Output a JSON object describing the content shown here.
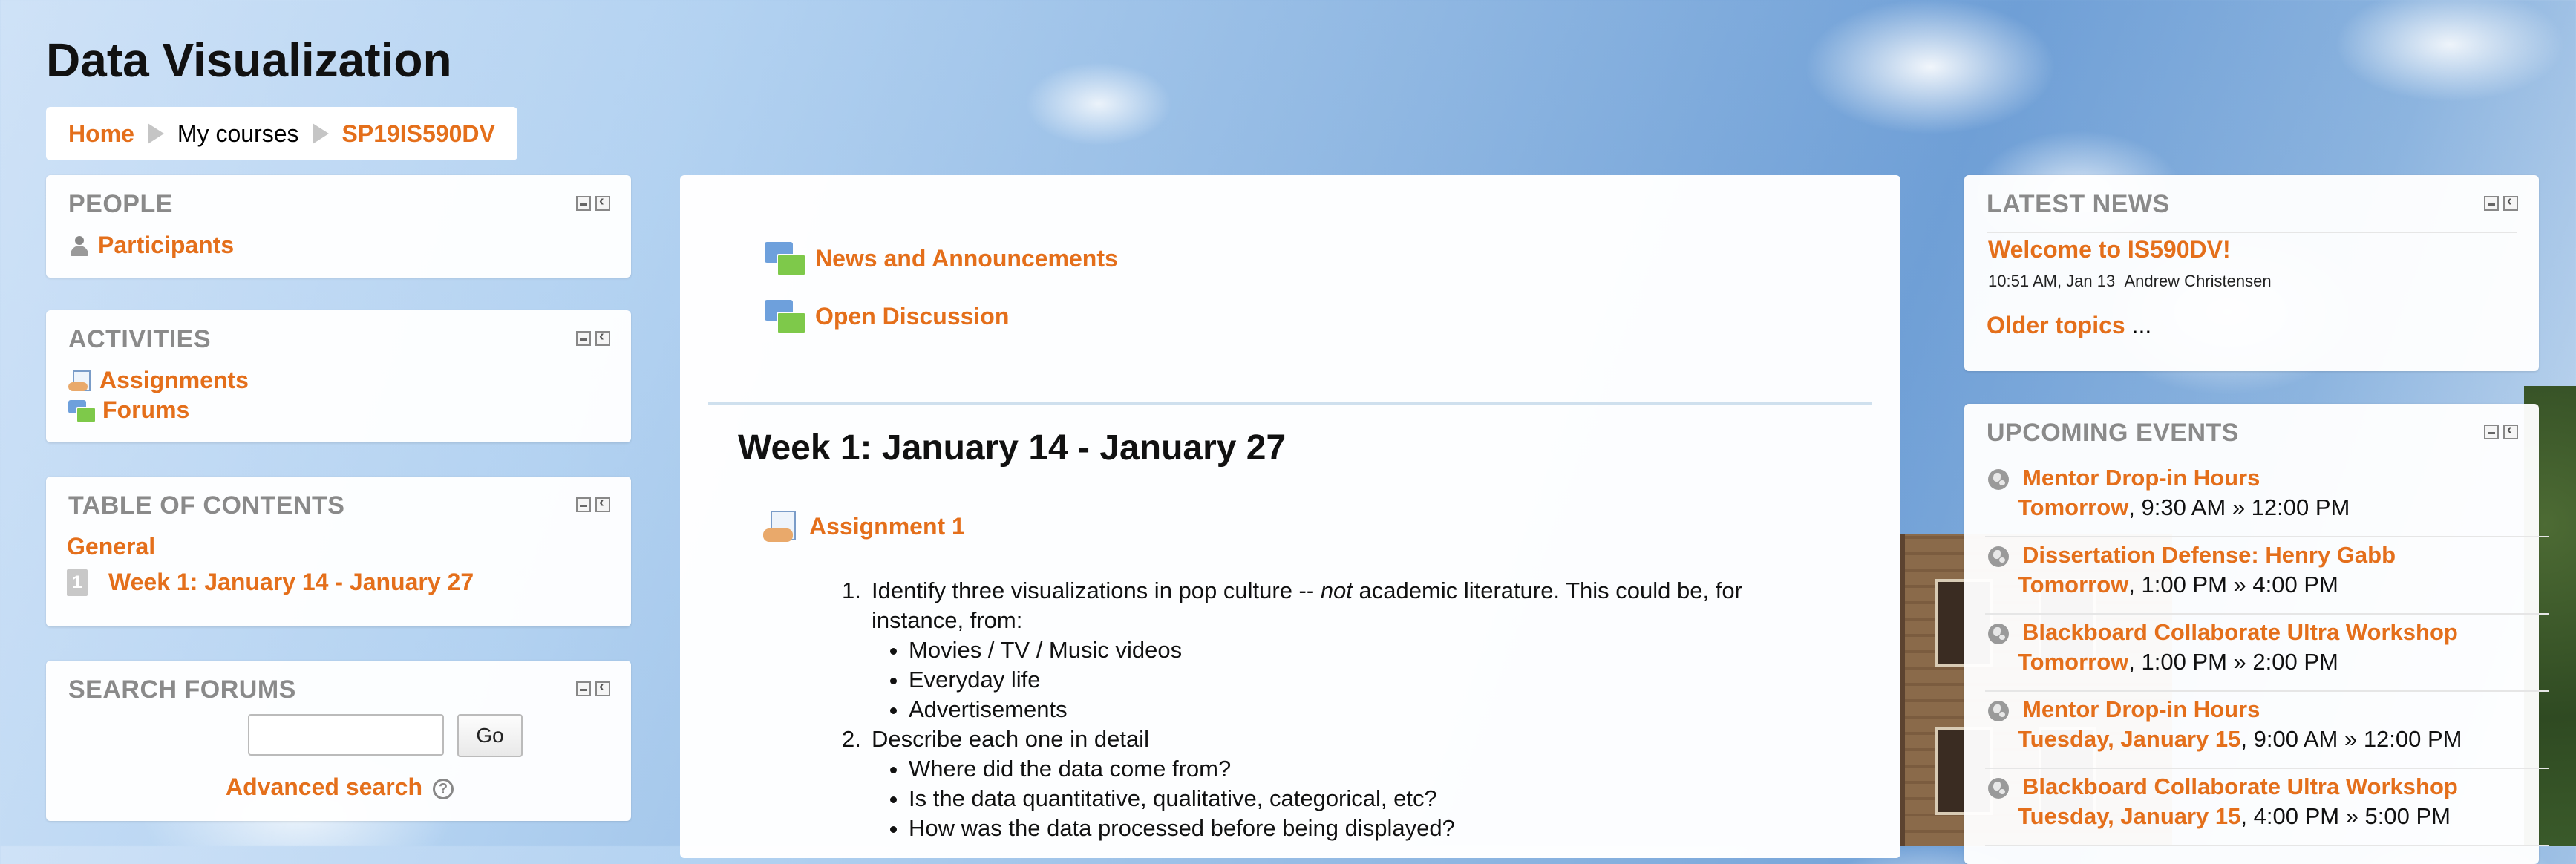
{
  "page": {
    "title": "Data Visualization"
  },
  "breadcrumb": {
    "home": "Home",
    "my_courses": "My courses",
    "course": "SP19IS590DV"
  },
  "people": {
    "title": "PEOPLE",
    "participants": "Participants"
  },
  "activities": {
    "title": "ACTIVITIES",
    "assignments": "Assignments",
    "forums": "Forums"
  },
  "toc": {
    "title": "TABLE OF CONTENTS",
    "general": "General",
    "week_num": "1",
    "week1": "Week 1: January 14 - January 27"
  },
  "search_forums": {
    "title": "SEARCH FORUMS",
    "input_value": "",
    "go": "Go",
    "advanced": "Advanced search",
    "help": "?"
  },
  "main": {
    "news_forum": "News and Announcements",
    "open_discussion": "Open Discussion",
    "week_title": "Week 1: January 14 - January 27",
    "assignment": "Assignment 1",
    "item1_num": "1.",
    "item1_a": "Identify three visualizations in pop culture -- ",
    "item1_em": "not",
    "item1_b": " academic literature. This could be, for instance, from:",
    "item1_bullets": [
      "Movies / TV / Music videos",
      "Everyday life",
      "Advertisements"
    ],
    "item2_num": "2.",
    "item2": "Describe each one in detail",
    "item2_bullets": [
      "Where did the data come from?",
      "Is the data quantitative, qualitative, categorical, etc?",
      "How was the data processed before being displayed?"
    ]
  },
  "latest_news": {
    "title": "LATEST NEWS",
    "post_title": "Welcome to IS590DV!",
    "post_time": "10:51 AM, Jan 13",
    "post_author": "Andrew Christensen",
    "older": "Older topics",
    "ellipsis": " ..."
  },
  "upcoming": {
    "title": "UPCOMING EVENTS",
    "events": [
      {
        "name": "Mentor Drop-in Hours",
        "day": "Tomorrow",
        "time": ", 9:30 AM » 12:00 PM"
      },
      {
        "name": "Dissertation Defense: Henry Gabb",
        "day": "Tomorrow",
        "time": ", 1:00 PM » 4:00 PM"
      },
      {
        "name": "Blackboard Collaborate Ultra Workshop",
        "day": "Tomorrow",
        "time": ", 1:00 PM » 2:00 PM"
      },
      {
        "name": "Mentor Drop-in Hours",
        "day": "Tuesday, January 15",
        "time": ", 9:00 AM » 12:00 PM"
      },
      {
        "name": "Blackboard Collaborate Ultra Workshop",
        "day": "Tuesday, January 15",
        "time": ", 4:00 PM » 5:00 PM"
      }
    ]
  },
  "colors": {
    "link": "#e46f1b",
    "block_title": "#8a8a8a"
  }
}
